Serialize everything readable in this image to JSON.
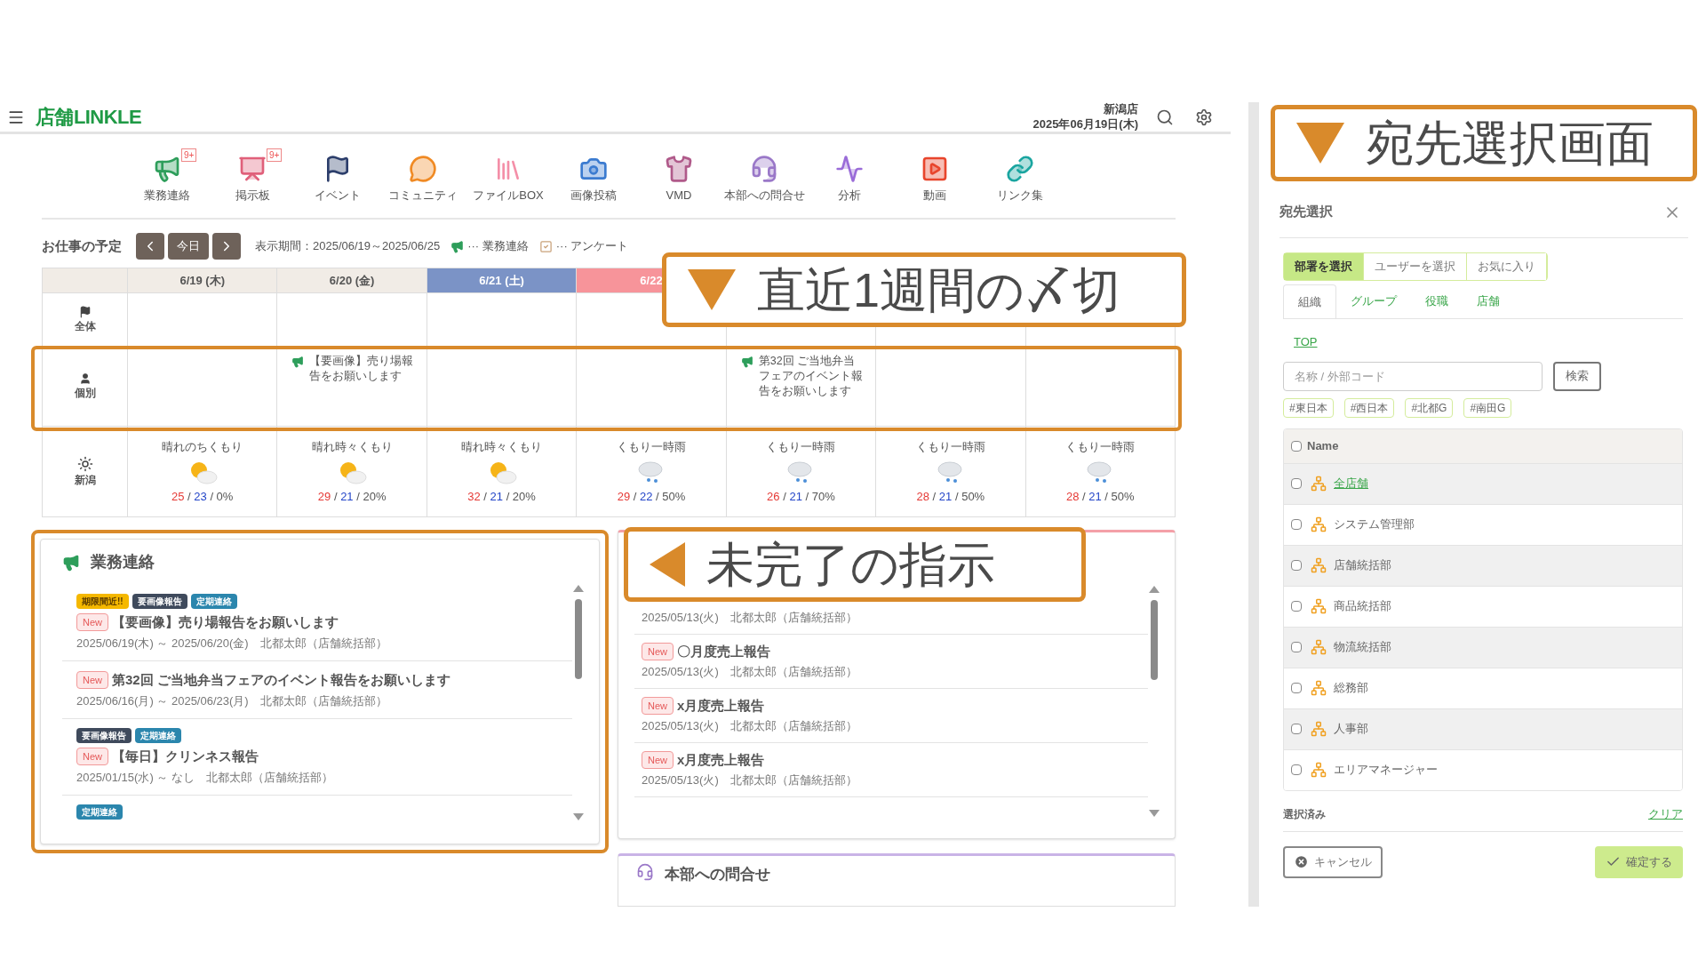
{
  "header": {
    "brand": "店舗LINKLE",
    "store": "新潟店",
    "date": "2025年06月19日(木)"
  },
  "nav": [
    {
      "label": "業務連絡",
      "badge": "9+"
    },
    {
      "label": "掲示板",
      "badge": "9+"
    },
    {
      "label": "イベント"
    },
    {
      "label": "コミュニティ"
    },
    {
      "label": "ファイルBOX"
    },
    {
      "label": "画像投稿"
    },
    {
      "label": "VMD"
    },
    {
      "label": "本部への問合せ"
    },
    {
      "label": "分析"
    },
    {
      "label": "動画"
    },
    {
      "label": "リンク集"
    }
  ],
  "schedule": {
    "title": "お仕事の予定",
    "today": "今日",
    "period": "表示期間：2025/06/19～2025/06/25",
    "legend": [
      {
        "label": "··· 業務連絡",
        "kind": "notice"
      },
      {
        "label": "··· アンケート",
        "kind": "survey"
      }
    ],
    "days": [
      {
        "label": "6/19 (木)",
        "kind": "weekday"
      },
      {
        "label": "6/20 (金)",
        "kind": "weekday"
      },
      {
        "label": "6/21 (土)",
        "kind": "saturday"
      },
      {
        "label": "6/22",
        "kind": "sunday"
      }
    ],
    "all_row": {
      "label": "全体"
    },
    "personal_row": {
      "label": "個別",
      "cells": [
        {
          "kind": "empty"
        },
        {
          "kind": "notice",
          "text": "【要画像】売り場報告をお願いします"
        },
        {
          "kind": "empty"
        },
        {
          "kind": "empty"
        },
        {
          "kind": "notice",
          "text": "第32回 ご当地弁当フェアのイベント報告をお願いします"
        },
        {
          "kind": "empty"
        },
        {
          "kind": "empty"
        }
      ]
    },
    "weather_row": {
      "label": "新潟",
      "separator": "/",
      "days": [
        {
          "forecast": "晴れのちくもり",
          "kind": "sun_cloud",
          "high": "25",
          "low": "23",
          "rain": "0%"
        },
        {
          "forecast": "晴れ時々くもり",
          "kind": "sun_cloud",
          "high": "29",
          "low": "21",
          "rain": "20%"
        },
        {
          "forecast": "晴れ時々くもり",
          "kind": "sun_cloud",
          "high": "32",
          "low": "21",
          "rain": "20%"
        },
        {
          "forecast": "くもり一時雨",
          "kind": "cloud_rain",
          "high": "29",
          "low": "22",
          "rain": "50%"
        },
        {
          "forecast": "くもり一時雨",
          "kind": "cloud_rain",
          "high": "26",
          "low": "21",
          "rain": "70%"
        },
        {
          "forecast": "くもり一時雨",
          "kind": "cloud_rain",
          "high": "28",
          "low": "21",
          "rain": "50%"
        },
        {
          "forecast": "くもり一時雨",
          "kind": "cloud_rain",
          "high": "28",
          "low": "21",
          "rain": "50%"
        }
      ]
    }
  },
  "notices": {
    "title": "業務連絡",
    "items": [
      {
        "tags": [
          {
            "label": "期限間近!!",
            "kind": "deadline"
          },
          {
            "label": "要画像報告",
            "kind": "image"
          },
          {
            "label": "定期連絡",
            "kind": "regular"
          }
        ],
        "badge": "New",
        "title": "【要画像】売り場報告をお願いします",
        "meta": "2025/06/19(木) ～ 2025/06/20(金)　北都太郎（店舗統括部）"
      },
      {
        "badge": "New",
        "title": "第32回 ご当地弁当フェアのイベント報告をお願いします",
        "meta": "2025/06/16(月) ～ 2025/06/23(月)　北都太郎（店舗統括部）"
      },
      {
        "tags": [
          {
            "label": "要画像報告",
            "kind": "image"
          },
          {
            "label": "定期連絡",
            "kind": "regular"
          }
        ],
        "badge": "New",
        "title": "【毎日】クリンネス報告",
        "meta": "2025/01/15(水) ～ なし　北都太郎（店舗統括部）"
      },
      {
        "tags": [
          {
            "label": "定期連絡",
            "kind": "regular"
          }
        ]
      }
    ]
  },
  "instructions": {
    "items": [
      {
        "meta": "2025/05/13(火)　北都太郎（店舗統括部）"
      },
      {
        "badge": "New",
        "title": "〇月度売上報告",
        "meta": "2025/05/13(火)　北都太郎（店舗統括部）"
      },
      {
        "badge": "New",
        "title": "x月度売上報告",
        "meta": "2025/05/13(火)　北都太郎（店舗統括部）"
      },
      {
        "badge": "New",
        "title": "x月度売上報告",
        "meta": "2025/05/13(火)　北都太郎（店舗統括部）"
      }
    ]
  },
  "inquiry": {
    "title": "本部への問合せ"
  },
  "dialog": {
    "title": "宛先選択",
    "tabs": [
      {
        "label": "部署を選択",
        "selected": true
      },
      {
        "label": "ユーザーを選択",
        "selected": false
      },
      {
        "label": "お気に入り",
        "selected": false
      }
    ],
    "subtabs": [
      {
        "label": "組織",
        "selected": true
      },
      {
        "label": "グループ",
        "selected": false
      },
      {
        "label": "役職",
        "selected": false
      },
      {
        "label": "店舗",
        "selected": false
      }
    ],
    "breadcrumb": "TOP",
    "search": {
      "placeholder": "名称 / 外部コード",
      "button": "検索"
    },
    "tags": [
      "#東日本",
      "#西日本",
      "#北都G",
      "#南田G"
    ],
    "table": {
      "header": "Name",
      "checked": false
    },
    "rows": [
      {
        "name": "全店舗",
        "link": true,
        "checked": false
      },
      {
        "name": "システム管理部",
        "link": false,
        "checked": false
      },
      {
        "name": "店舗統括部",
        "link": false,
        "checked": false
      },
      {
        "name": "商品統括部",
        "link": false,
        "checked": false
      },
      {
        "name": "物流統括部",
        "link": false,
        "checked": false
      },
      {
        "name": "総務部",
        "link": false,
        "checked": false
      },
      {
        "name": "人事部",
        "link": false,
        "checked": false
      },
      {
        "name": "エリアマネージャー",
        "link": false,
        "checked": false
      }
    ],
    "selected_label": "選択済み",
    "clear": "クリア",
    "cancel": "キャンセル",
    "confirm": "確定する"
  },
  "callouts": [
    {
      "text": "直近1週間の〆切",
      "kind": "down"
    },
    {
      "text": "未完了の指示",
      "kind": "left"
    },
    {
      "text": "宛先選択画面",
      "kind": "down"
    }
  ]
}
